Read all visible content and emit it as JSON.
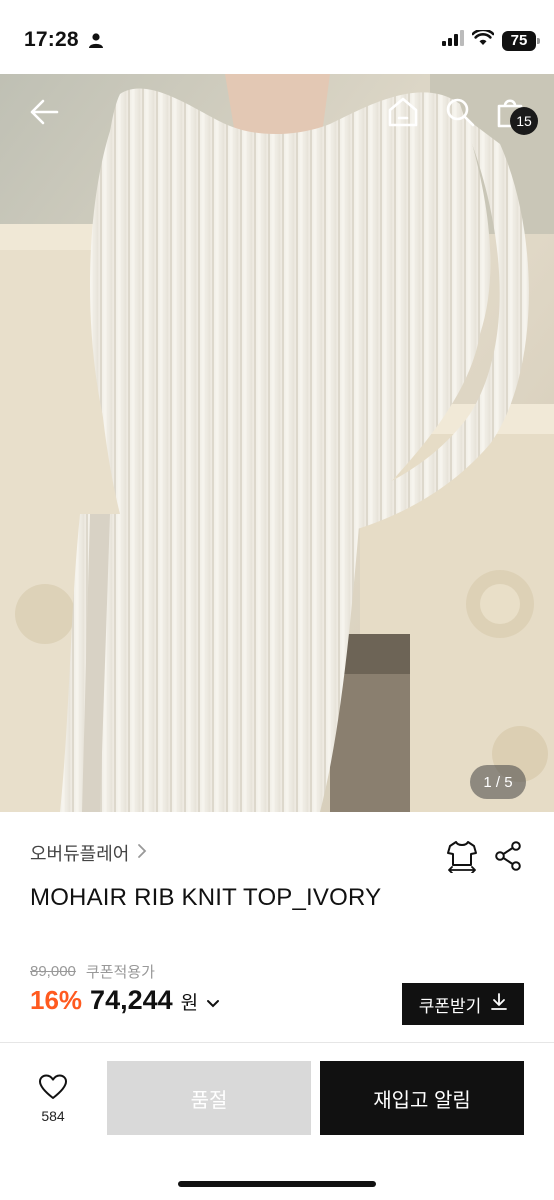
{
  "status_bar": {
    "time": "17:28",
    "battery": "75"
  },
  "hero": {
    "cart_count": "15",
    "pager": "1 / 5"
  },
  "product": {
    "brand": "오버듀플레어",
    "name": "MOHAIR RIB KNIT TOP_IVORY",
    "original_price": "89,000",
    "coupon_price_label": "쿠폰적용가",
    "discount": "16%",
    "price": "74,244",
    "currency": "원",
    "coupon_button": "쿠폰받기"
  },
  "bottom_bar": {
    "like_count": "584",
    "soldout_label": "품절",
    "restock_label": "재입고 알림"
  },
  "colors": {
    "accent_discount": "#ff5a1f",
    "primary_button": "#111111",
    "disabled_button": "#d9d9d9"
  }
}
